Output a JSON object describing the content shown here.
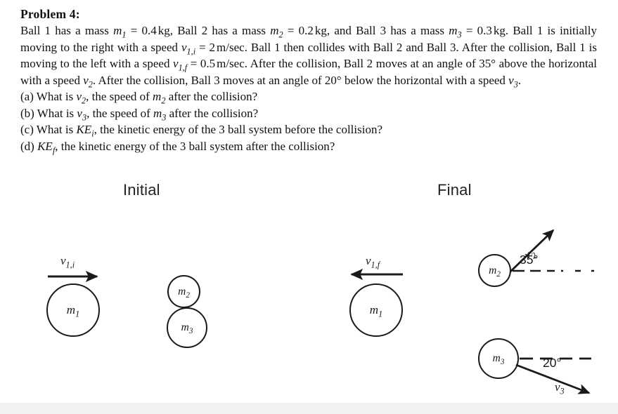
{
  "problem": {
    "title": "Problem 4:",
    "body_lines": [
      "Ball 1 has a mass m₁ = 0.4 kg, Ball 2 has a mass m₂ = 0.2 kg, and Ball 3 has a mass m₃ = 0.3 kg. Ball 1 is",
      "initially moving to the right with a speed v₁,ᵢ = 2 m/sec. Ball 1 then collides with Ball 2 and Ball 3. After",
      "the collision, Ball 1 is moving to the left with a speed v₁,ғ = 0.5 m/sec. After the collision, Ball 2 moves",
      "at an angle of 35° above the horizontal with a speed v₂. After the collision, Ball 3 moves at an angle of",
      "20° below the horizontal with a speed v₃."
    ],
    "questions": [
      "(a) What is v₂, the speed of m₂ after the collision?",
      "(b) What is v₃, the speed of m₃ after the collision?",
      "(c) What is KEᵢ, the kinetic energy of the 3 ball system before the collision?",
      "(d) KEғ, the kinetic energy of the 3 ball system after the collision?"
    ],
    "givens": {
      "m1": "0.4 kg",
      "m2": "0.2 kg",
      "m3": "0.3 kg",
      "v1i": "2 m/sec",
      "v1f": "0.5 m/sec",
      "angle_m2": "35°",
      "angle_m3": "20°"
    }
  },
  "figure": {
    "initial": {
      "heading": "Initial",
      "ball_m1_label": "m",
      "ball_m1_sub": "1",
      "ball_m2_label": "m",
      "ball_m2_sub": "2",
      "ball_m3_label": "m",
      "ball_m3_sub": "3",
      "velocity_label": "v",
      "velocity_sub": "1,i"
    },
    "final": {
      "heading": "Final",
      "ball_m1_label": "m",
      "ball_m1_sub": "1",
      "ball_m2_label": "m",
      "ball_m2_sub": "2",
      "ball_m3_label": "m",
      "ball_m3_sub": "3",
      "v1f_label": "v",
      "v1f_sub": "1,f",
      "v2_label": "v",
      "v2_sub": "2",
      "v3_label": "v",
      "v3_sub": "3",
      "angle_m2_label": "35°",
      "angle_m3_label": "20°"
    }
  },
  "colors": {
    "ink": "#1a1a1a",
    "text": "#111111",
    "background": "#ffffff",
    "bottom_band": "#f2f2f2"
  }
}
